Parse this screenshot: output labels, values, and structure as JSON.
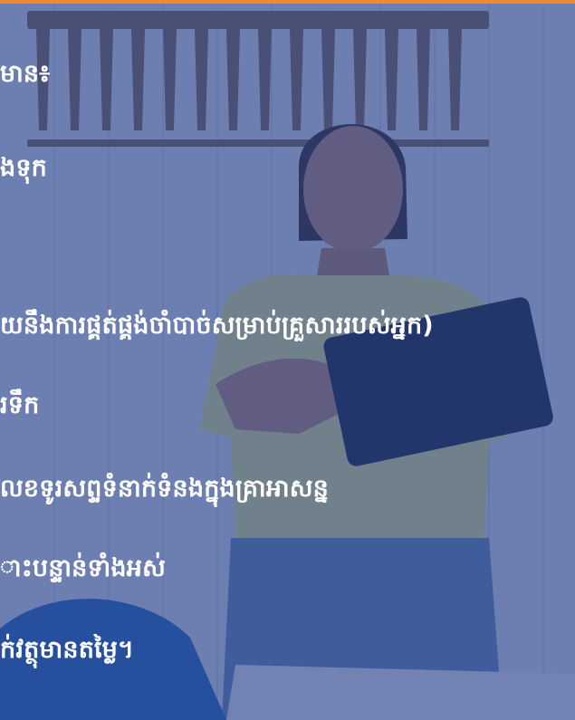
{
  "colors": {
    "accent_bar": "#f0892a",
    "overlay": "#223e8a",
    "text": "#ffffff"
  },
  "lines": [
    "មាន៖",
    "ងទុក",
    "យនឹងការផ្គត់ផ្គង់ចាំបាច់សម្រាប់គ្រួសាររបស់អ្នក)",
    "រទឹក",
    "លខទូរសព្ទទំនាក់ទំនងក្នុងគ្រាអាសន្ន",
    "ាះបន្ទាន់ទាំងអស់",
    "ក់វត្ថុមានតម្លៃ។"
  ]
}
